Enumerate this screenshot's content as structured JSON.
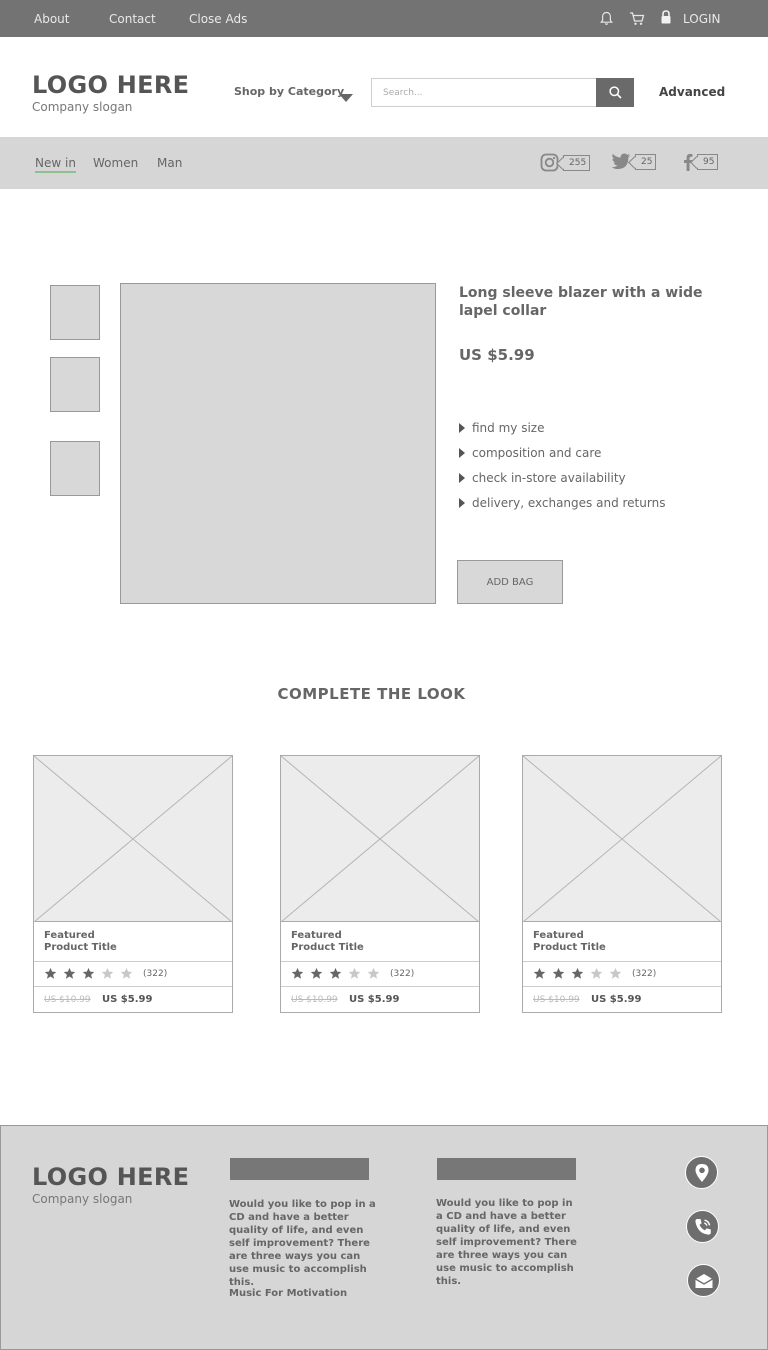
{
  "topbar": {
    "about": "About",
    "contact": "Contact",
    "close_ads": "Close Ads",
    "login": "LOGIN",
    "icons": [
      "bell-icon",
      "cart-icon",
      "lock-icon"
    ]
  },
  "header": {
    "logo": "LOGO HERE",
    "slogan": "Company slogan",
    "shop_category": "Shop by Category",
    "search_placeholder": "Search...",
    "advanced": "Advanced"
  },
  "nav": {
    "items": [
      "New in",
      "Women",
      "Man"
    ],
    "social": [
      {
        "icon": "instagram-icon",
        "count": "255"
      },
      {
        "icon": "twitter-icon",
        "count": "25"
      },
      {
        "icon": "facebook-icon",
        "count": "95"
      }
    ]
  },
  "product": {
    "title": "Long sleeve blazer with a wide lapel collar",
    "price": "US $5.99",
    "details": [
      "find my size",
      "composition and care",
      "check in-store availability",
      "delivery, exchanges and returns"
    ],
    "add_bag": "ADD BAG"
  },
  "complete_look": {
    "title": "COMPLETE THE LOOK",
    "cards": [
      {
        "title_line1": "Featured",
        "title_line2": "Product Title",
        "rating": 3,
        "reviews": "(322)",
        "old_price": "US $10.99",
        "new_price": "US $5.99"
      },
      {
        "title_line1": "Featured",
        "title_line2": "Product Title",
        "rating": 3,
        "reviews": "(322)",
        "old_price": "US $10.99",
        "new_price": "US $5.99"
      },
      {
        "title_line1": "Featured",
        "title_line2": "Product Title",
        "rating": 3,
        "reviews": "(322)",
        "old_price": "US $10.99",
        "new_price": "US $5.99"
      }
    ]
  },
  "footer": {
    "logo": "LOGO HERE",
    "slogan": "Company slogan",
    "col1_text": "Would you like to pop in a CD and have a better quality of life, and even self improvement? There are three ways you can use music to accomplish this.",
    "col1_link": "Music For Motivation",
    "col2_text": "Would you like to pop in a CD and have a better quality of life, and even self improvement? There are three ways you can use music to accomplish this.",
    "icons": [
      "location-icon",
      "phone-icon",
      "mail-icon"
    ]
  },
  "colors": {
    "topbar": "#737373",
    "nav": "#d6d6d6",
    "placeholder": "#d8d8d8",
    "active_underline": "#8fbf8a"
  }
}
